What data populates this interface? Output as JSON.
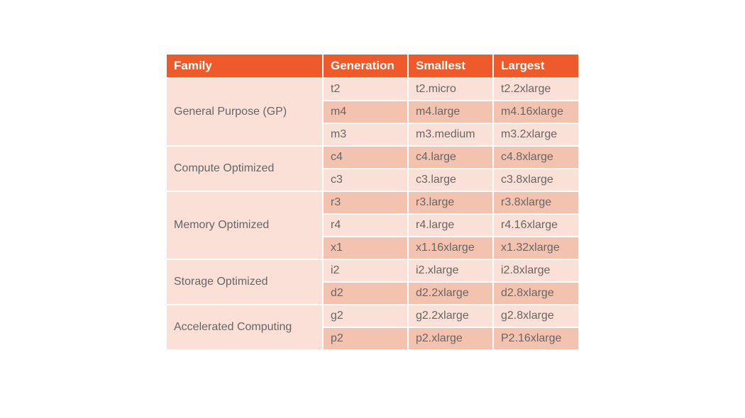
{
  "headers": {
    "family": "Family",
    "generation": "Generation",
    "smallest": "Smallest",
    "largest": "Largest"
  },
  "families": [
    {
      "name": "General Purpose (GP)",
      "rows": [
        {
          "generation": "t2",
          "smallest": "t2.micro",
          "largest": "t2.2xlarge",
          "shade": "light"
        },
        {
          "generation": "m4",
          "smallest": "m4.large",
          "largest": "m4.16xlarge",
          "shade": "dark"
        },
        {
          "generation": "m3",
          "smallest": "m3.medium",
          "largest": "m3.2xlarge",
          "shade": "light"
        }
      ]
    },
    {
      "name": "Compute Optimized",
      "rows": [
        {
          "generation": "c4",
          "smallest": "c4.large",
          "largest": "c4.8xlarge",
          "shade": "dark"
        },
        {
          "generation": "c3",
          "smallest": "c3.large",
          "largest": "c3.8xlarge",
          "shade": "light"
        }
      ]
    },
    {
      "name": "Memory Optimized",
      "rows": [
        {
          "generation": "r3",
          "smallest": "r3.large",
          "largest": "r3.8xlarge",
          "shade": "dark"
        },
        {
          "generation": "r4",
          "smallest": "r4.large",
          "largest": "r4.16xlarge",
          "shade": "light"
        },
        {
          "generation": "x1",
          "smallest": "x1.16xlarge",
          "largest": "x1.32xlarge",
          "shade": "dark"
        }
      ]
    },
    {
      "name": "Storage Optimized",
      "rows": [
        {
          "generation": "i2",
          "smallest": "i2.xlarge",
          "largest": "i2.8xlarge",
          "shade": "light"
        },
        {
          "generation": "d2",
          "smallest": "d2.2xlarge",
          "largest": "d2.8xlarge",
          "shade": "dark"
        }
      ]
    },
    {
      "name": "Accelerated Computing",
      "rows": [
        {
          "generation": "g2",
          "smallest": "g2.2xlarge",
          "largest": "g2.8xlarge",
          "shade": "light"
        },
        {
          "generation": "p2",
          "smallest": "p2.xlarge",
          "largest": "P2.16xlarge",
          "shade": "dark"
        }
      ]
    }
  ]
}
